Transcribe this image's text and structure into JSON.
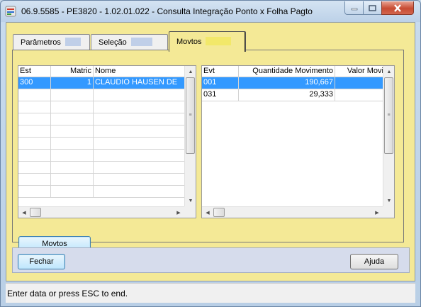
{
  "window": {
    "title": "06.9.5585 - PE3820 - 1.02.01.022 - Consulta Integração Ponto x Folha Pagto"
  },
  "tabs": [
    {
      "label": "Parâmetros",
      "swatch": "#c0cfe8"
    },
    {
      "label": "Seleção",
      "swatch": "#c0cfe8"
    },
    {
      "label": "Movtos",
      "swatch": "#f2e86a"
    }
  ],
  "left_grid": {
    "columns": [
      "Est",
      "Matric",
      "Nome"
    ],
    "rows": [
      [
        "300",
        "1",
        "CLAUDIO HAUSEN DE"
      ]
    ]
  },
  "right_grid": {
    "columns": [
      "Evt",
      "Quantidade Movimento",
      "Valor Movi"
    ],
    "rows": [
      [
        "001",
        "190,667",
        ""
      ],
      [
        "031",
        "29,333",
        ""
      ]
    ]
  },
  "buttons": {
    "movtos": "Movtos",
    "fechar": "Fechar",
    "ajuda": "Ajuda"
  },
  "status": "Enter data or press ESC to end."
}
